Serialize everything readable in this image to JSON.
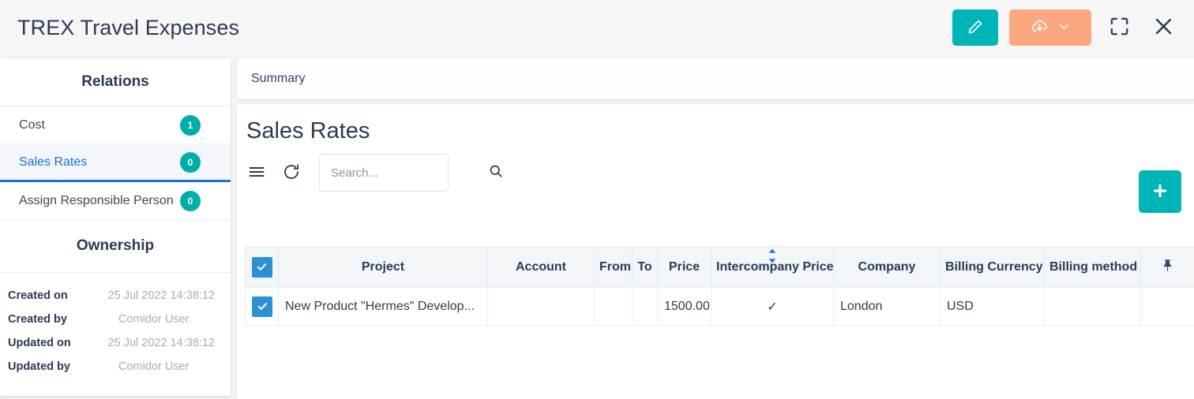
{
  "header": {
    "title": "TREX Travel Expenses",
    "actions": [
      {
        "name": "edit-button",
        "icon": "pencil-icon",
        "color": "#00b5b8"
      },
      {
        "name": "export-button",
        "icon": "cloud-download-icon",
        "color": "#fba780",
        "chevron": "chevron-down-icon"
      },
      {
        "name": "fullscreen-button",
        "icon": "fullscreen-icon"
      },
      {
        "name": "close-button",
        "icon": "close-icon"
      }
    ]
  },
  "sidebar": {
    "relations_heading": "Relations",
    "items": [
      {
        "label": "Cost",
        "badge": "1",
        "active": false
      },
      {
        "label": "Sales Rates",
        "badge": "0",
        "active": true
      },
      {
        "label": "Assign Responsible Person",
        "badge": "0",
        "active": false
      }
    ],
    "ownership_heading": "Ownership",
    "ownership": [
      {
        "key": "Created on",
        "value": "25 Jul 2022 14:38:12"
      },
      {
        "key": "Created by",
        "value": "Comidor User"
      },
      {
        "key": "Updated on",
        "value": "25 Jul 2022 14:38:12"
      },
      {
        "key": "Updated by",
        "value": "Comidor User"
      }
    ]
  },
  "main": {
    "tab_label": "Summary",
    "page_title": "Sales Rates",
    "toolbar": {
      "menu_icon": "hamburger-menu-icon",
      "refresh_icon": "refresh-icon",
      "search_placeholder": "Search...",
      "search_value": "",
      "search_icon": "search-icon"
    },
    "add_button_label": "+",
    "table": {
      "columns": [
        "Project",
        "Account",
        "From",
        "To",
        "Price",
        "Intercompany Price",
        "Company",
        "Billing Currency",
        "Billing method"
      ],
      "sorted_column": "Intercompany Price",
      "pin_icon": "pin-icon",
      "header_checkbox_checked": true,
      "rows": [
        {
          "selected": true,
          "Project": "New Product \"Hermes\" Develop...",
          "Account": "",
          "From": "",
          "To": "",
          "Price": "1500.00",
          "Intercompany Price": "✓",
          "Company": "London",
          "Billing Currency": "USD",
          "Billing method": ""
        }
      ]
    }
  },
  "colors": {
    "teal": "#00b5b8",
    "orange": "#fba780",
    "badge_teal": "#00ada9",
    "accent_blue": "#1a6fd4",
    "checkbox_blue": "#2d8fd5"
  }
}
